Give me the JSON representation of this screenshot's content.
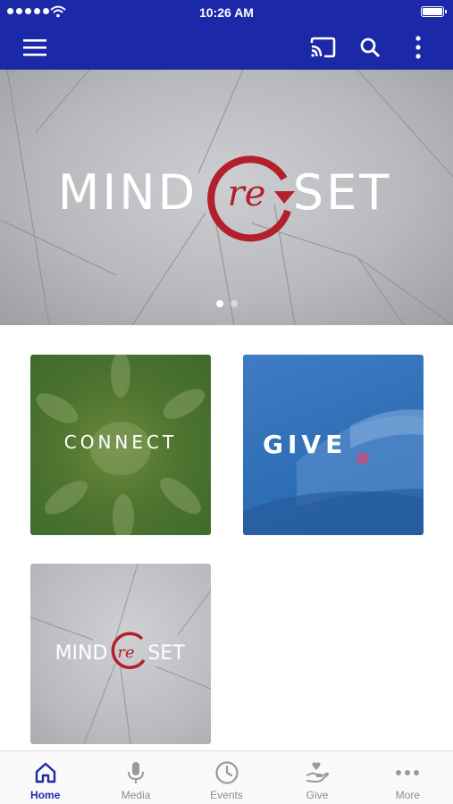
{
  "status_bar": {
    "time": "10:26 AM"
  },
  "app_bar": {
    "menu_icon": "hamburger-icon",
    "cast_icon": "cast-icon",
    "search_icon": "search-icon",
    "more_icon": "vertical-dots-icon"
  },
  "hero": {
    "logo_left": "MIND",
    "logo_circle": "re",
    "logo_right": "SET",
    "slide_count": 2,
    "active_slide": 1
  },
  "tiles": {
    "connect": "CONNECT",
    "give": "GIVE",
    "reset": {
      "left": "MIND",
      "circle": "re",
      "right": "SET"
    }
  },
  "bottom_nav": {
    "items": [
      {
        "label": "Home",
        "icon": "home-icon",
        "active": true
      },
      {
        "label": "Media",
        "icon": "microphone-icon",
        "active": false
      },
      {
        "label": "Events",
        "icon": "clock-icon",
        "active": false
      },
      {
        "label": "Give",
        "icon": "heart-hand-icon",
        "active": false
      },
      {
        "label": "More",
        "icon": "horizontal-dots-icon",
        "active": false
      }
    ]
  },
  "colors": {
    "primary": "#1b28a8",
    "logo_red": "#b3202a",
    "connect_green": "#4f7530",
    "give_blue": "#2f6fb6"
  }
}
